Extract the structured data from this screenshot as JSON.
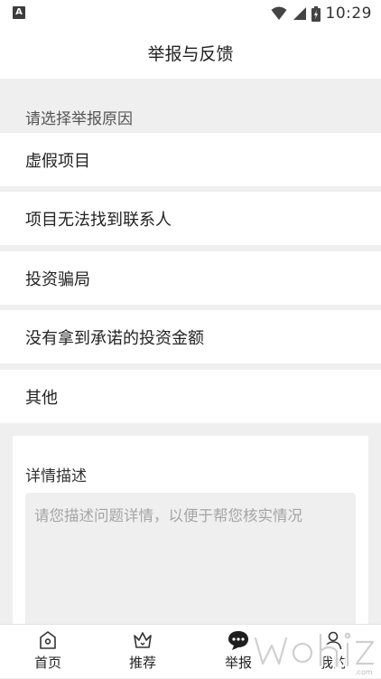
{
  "status_bar": {
    "time": "10:29"
  },
  "header": {
    "title": "举报与反馈"
  },
  "reasons": {
    "prompt": "请选择举报原因",
    "items": [
      {
        "label": "虚假项目"
      },
      {
        "label": "项目无法找到联系人"
      },
      {
        "label": "投资骗局"
      },
      {
        "label": "没有拿到承诺的投资金额"
      },
      {
        "label": "其他"
      }
    ]
  },
  "detail": {
    "label": "详情描述",
    "placeholder": "请您描述问题详情，以便于帮您核实情况"
  },
  "tabbar": {
    "tabs": [
      {
        "label": "首页",
        "icon": "home-icon"
      },
      {
        "label": "推荐",
        "icon": "crown-icon"
      },
      {
        "label": "举报",
        "icon": "chat-bubble-icon",
        "active": true
      },
      {
        "label": "我的",
        "icon": "person-icon"
      }
    ]
  },
  "colors": {
    "background": "#efefef",
    "card": "#ffffff",
    "placeholder": "#a5a5a5"
  }
}
